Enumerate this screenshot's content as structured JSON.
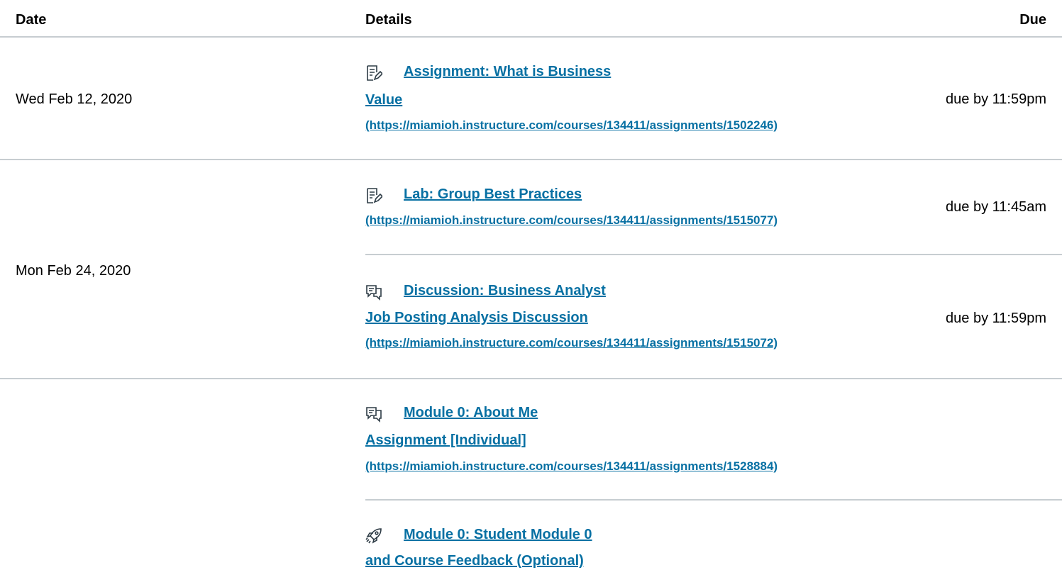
{
  "header": {
    "date_label": "Date",
    "details_label": "Details",
    "due_label": "Due"
  },
  "groups": [
    {
      "date": "Wed Feb 12, 2020"
    },
    {
      "date": "Mon Feb 24, 2020"
    },
    {
      "date": ""
    }
  ],
  "items": [
    {
      "icon": "assignment-icon",
      "title_lines": [
        "Assignment: What is Business",
        "Value"
      ],
      "url": "(https://miamioh.instructure.com/courses/134411/assignments/1502246)",
      "due": "due by 11:59pm"
    },
    {
      "icon": "assignment-icon",
      "title_lines": [
        "Lab: Group Best Practices"
      ],
      "url": "(https://miamioh.instructure.com/courses/134411/assignments/1515077)",
      "due": "due by 11:45am"
    },
    {
      "icon": "discussion-icon",
      "title_lines": [
        "Discussion: Business Analyst",
        "Job Posting Analysis Discussion"
      ],
      "url": "(https://miamioh.instructure.com/courses/134411/assignments/1515072)",
      "due": "due by 11:59pm"
    },
    {
      "icon": "discussion-icon",
      "title_lines": [
        "Module 0: About Me",
        "Assignment [Individual]"
      ],
      "url": "(https://miamioh.instructure.com/courses/134411/assignments/1528884)",
      "due": ""
    },
    {
      "icon": "rocket-icon",
      "title_lines": [
        "Module 0: Student Module 0",
        "and Course Feedback (Optional)"
      ],
      "url": "",
      "due": ""
    }
  ],
  "colors": {
    "link": "#0770a3",
    "divider": "#c7cdd1",
    "text": "#000000"
  }
}
